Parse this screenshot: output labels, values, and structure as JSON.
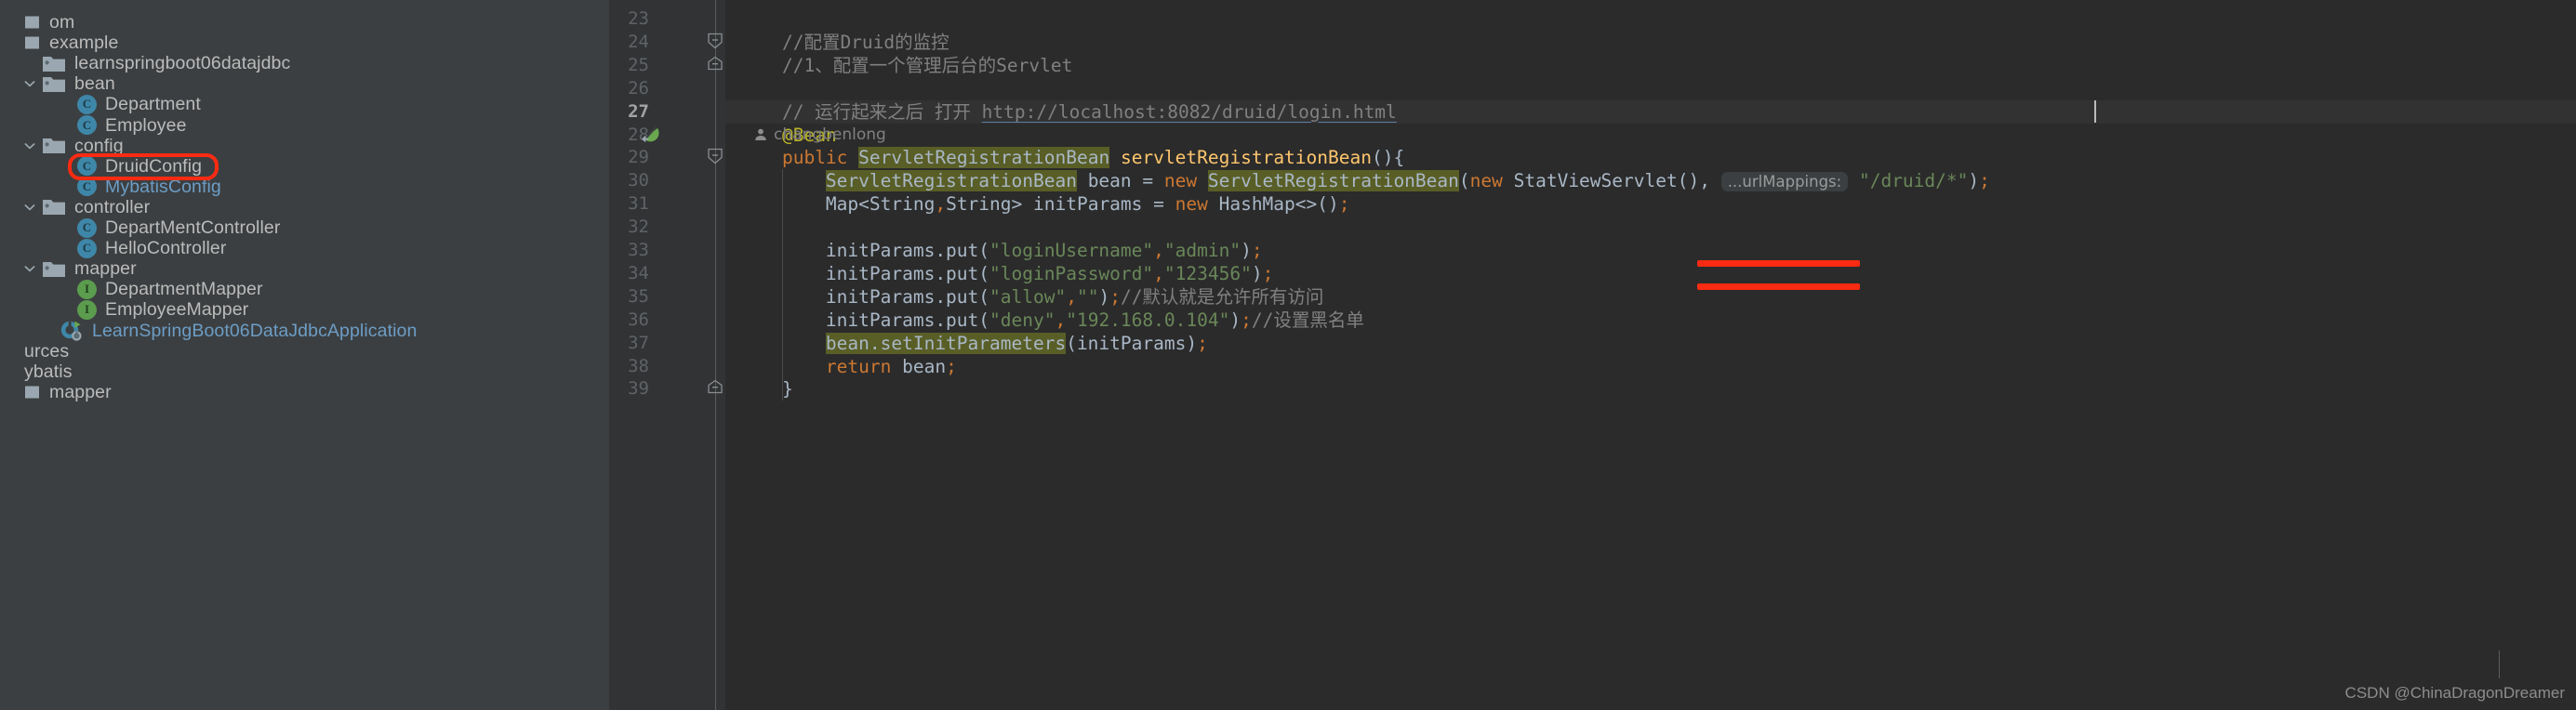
{
  "sidebar": {
    "tree": [
      {
        "indent": 0,
        "chevron": "none",
        "icon": "package-icon",
        "label": "om",
        "color": "grey",
        "partial": true
      },
      {
        "indent": 0,
        "chevron": "none",
        "icon": "package-square-icon",
        "label": "example",
        "color": "grey"
      },
      {
        "indent": 1,
        "chevron": "none",
        "icon": "folder-icon",
        "label": "learnspringboot06datajdbc",
        "color": "grey"
      },
      {
        "indent": 1,
        "chevron": "down",
        "icon": "folder-icon",
        "label": "bean",
        "color": "grey"
      },
      {
        "indent": 3,
        "chevron": "none",
        "icon": "class-icon",
        "label": "Department",
        "color": "grey"
      },
      {
        "indent": 3,
        "chevron": "none",
        "icon": "class-icon",
        "label": "Employee",
        "color": "grey"
      },
      {
        "indent": 1,
        "chevron": "down",
        "icon": "folder-icon",
        "label": "config",
        "color": "grey"
      },
      {
        "indent": 3,
        "chevron": "none",
        "icon": "class-icon",
        "label": "DruidConfig",
        "color": "grey"
      },
      {
        "indent": 3,
        "chevron": "none",
        "icon": "class-icon",
        "label": "MybatisConfig",
        "color": "blue"
      },
      {
        "indent": 1,
        "chevron": "down",
        "icon": "folder-icon",
        "label": "controller",
        "color": "grey"
      },
      {
        "indent": 3,
        "chevron": "none",
        "icon": "class-icon",
        "label": "DepartMentController",
        "color": "grey"
      },
      {
        "indent": 3,
        "chevron": "none",
        "icon": "class-icon",
        "label": "HelloController",
        "color": "grey"
      },
      {
        "indent": 1,
        "chevron": "down",
        "icon": "folder-icon",
        "label": "mapper",
        "color": "grey"
      },
      {
        "indent": 3,
        "chevron": "none",
        "icon": "interface-icon",
        "label": "DepartmentMapper",
        "color": "grey"
      },
      {
        "indent": 3,
        "chevron": "none",
        "icon": "interface-icon",
        "label": "EmployeeMapper",
        "color": "grey"
      },
      {
        "indent": 2,
        "chevron": "none",
        "icon": "spring-app-icon",
        "label": "LearnSpringBoot06DataJdbcApplication",
        "color": "blue"
      },
      {
        "indent": 0,
        "chevron": "none",
        "icon": "none",
        "label": "urces",
        "color": "grey",
        "partial": true
      },
      {
        "indent": 0,
        "chevron": "none",
        "icon": "none",
        "label": "ybatis",
        "color": "grey",
        "partial": true
      },
      {
        "indent": 0,
        "chevron": "none",
        "icon": "package-square-icon",
        "label": "mapper",
        "color": "grey"
      }
    ],
    "highlight_target": "DruidConfig",
    "highlight_color": "#fa2b12"
  },
  "editor": {
    "current_line": 27,
    "inlay_author": "changbenlong",
    "param_hint": "...urlMappings:",
    "lines": [
      {
        "n": 23,
        "text": ""
      },
      {
        "n": 24,
        "text": "    //配置Druid的监控"
      },
      {
        "n": 25,
        "text": "    //1、配置一个管理后台的Servlet"
      },
      {
        "n": 26,
        "text": ""
      },
      {
        "n": 27,
        "text": "    // 运行起来之后 打开 http://localhost:8082/druid/login.html"
      },
      {
        "n": 28,
        "text": "    @Bean"
      },
      {
        "n": 29,
        "text": "    public ServletRegistrationBean servletRegistrationBean(){"
      },
      {
        "n": 30,
        "text": "        ServletRegistrationBean bean = new ServletRegistrationBean(new StatViewServlet(),  \"/druid/*\");"
      },
      {
        "n": 31,
        "text": "        Map<String,String> initParams = new HashMap<>();"
      },
      {
        "n": 32,
        "text": ""
      },
      {
        "n": 33,
        "text": "        initParams.put(\"loginUsername\",\"admin\");"
      },
      {
        "n": 34,
        "text": "        initParams.put(\"loginPassword\",\"123456\");"
      },
      {
        "n": 35,
        "text": "        initParams.put(\"allow\",\"\");//默认就是允许所有访问"
      },
      {
        "n": 36,
        "text": "        initParams.put(\"deny\",\"192.168.0.104\");//设置黑名单"
      },
      {
        "n": 37,
        "text": "        bean.setInitParameters(initParams);"
      },
      {
        "n": 38,
        "text": "        return bean;"
      },
      {
        "n": 39,
        "text": "    }"
      }
    ],
    "url": "http://localhost:8082/druid/login.html",
    "fold_markers": [
      24,
      25,
      29,
      39
    ],
    "gutter_icons": [
      {
        "line": 27,
        "icon": "lightbulb-icon",
        "color": "#edac2c"
      },
      {
        "line": 28,
        "icon": "spring-bean-icon",
        "color": "#5b9c4e"
      }
    ],
    "annotations": [
      {
        "kind": "red-underline",
        "target": "\"admin\"",
        "line": 33
      },
      {
        "kind": "red-underline",
        "target": "\"123456\"",
        "line": 34
      }
    ]
  },
  "watermark": "CSDN @ChinaDragonDreamer"
}
